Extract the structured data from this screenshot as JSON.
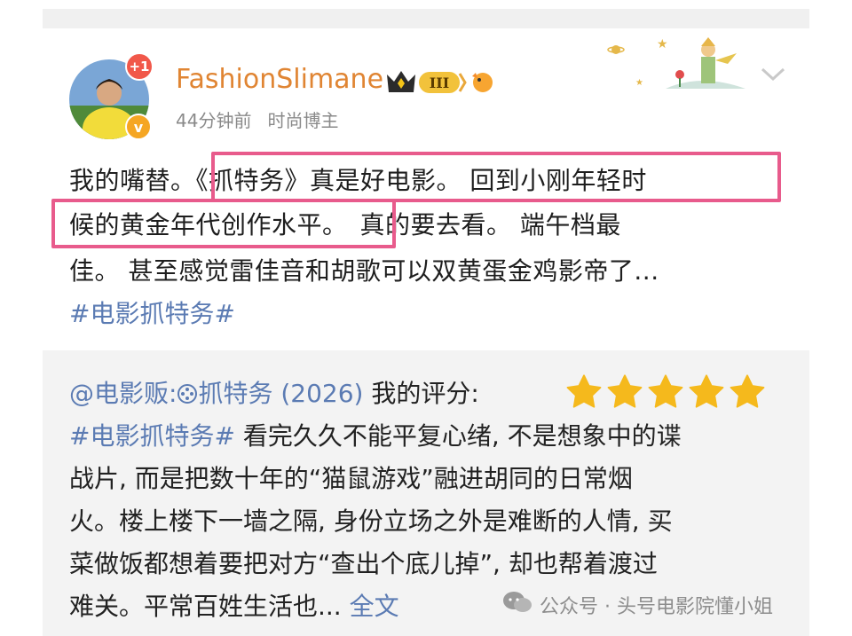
{
  "header": {
    "user": "FashionSlimane",
    "level": "III",
    "time": "44分钟前",
    "role": "时尚博主",
    "notif_count": "+1",
    "verified": "v"
  },
  "post": {
    "line1a": "我的嘴替。",
    "line1b": "《抓特务》真是好电影。 回到小刚年轻时",
    "line2a": "候的黄金年代创作水平。",
    "line2b": "真的要去看。 端午档最",
    "line3": "佳。 甚至感觉雷佳音和胡歌可以双黄蛋金鸡影帝了...",
    "tag": "#电影抓特务#"
  },
  "card": {
    "head_prefix": "@电影贩:",
    "head_movie": "抓特务 (2026)",
    "head_suffix": " 我的评分:",
    "rating": 5,
    "line1_tag": "#电影抓特务#",
    "line1": " 看完久久不能平复心绪, 不是想象中的谍",
    "line2": "战片, 而是把数十年的“猫鼠游戏”融进胡同的日常烟",
    "line3": "火。楼上楼下一墙之隔, 身份立场之外是难断的人情, 买",
    "line4": "菜做饭都想着要把对方“查出个底儿掉”, 却也帮着渡过",
    "line5": "难关。平常百姓生活也...",
    "full_text": "全文"
  },
  "watermark": {
    "text": "公众号 · 头号电影院懂小姐"
  }
}
